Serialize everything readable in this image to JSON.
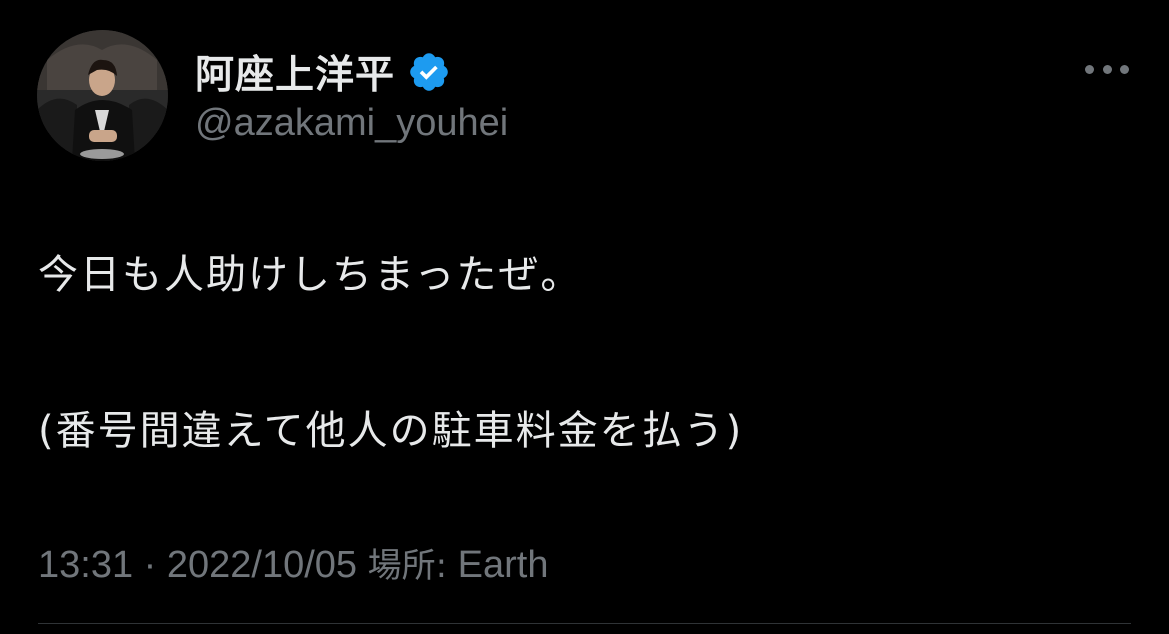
{
  "tweet": {
    "author": {
      "display_name": "阿座上洋平",
      "handle": "@azakami_youhei",
      "verified": true,
      "avatar_icon": "profile-photo"
    },
    "text_lines": [
      "今日も人助けしちまったぜ。",
      "(番号間違えて他人の駐車料金を払う)"
    ],
    "meta": {
      "time": "13:31",
      "separator": "·",
      "date": "2022/10/05",
      "location_label": "場所:",
      "location": "Earth"
    },
    "more_icon": "more-horizontal-icon"
  },
  "colors": {
    "background": "#000000",
    "primary_text": "#e7e9ea",
    "secondary_text": "#71767b",
    "verified_blue": "#1d9bf0"
  }
}
